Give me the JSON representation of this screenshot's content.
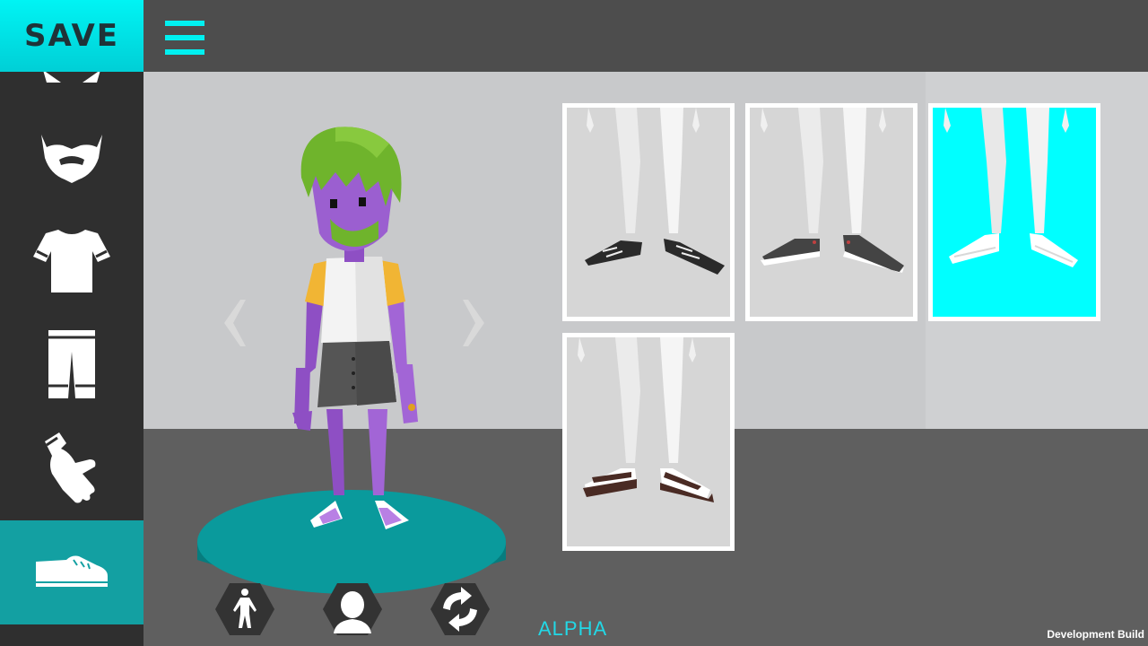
{
  "header": {
    "save_label": "SAVE",
    "menu_icon": "hamburger-menu-icon"
  },
  "sidebar": {
    "items": [
      {
        "name": "hair-category",
        "icon": "hair-icon",
        "active": false
      },
      {
        "name": "beard-category",
        "icon": "beard-icon",
        "active": false
      },
      {
        "name": "shirt-category",
        "icon": "shirt-icon",
        "active": false
      },
      {
        "name": "pants-category",
        "icon": "pants-icon",
        "active": false
      },
      {
        "name": "gloves-category",
        "icon": "glove-icon",
        "active": false
      },
      {
        "name": "shoes-category",
        "icon": "shoe-icon",
        "active": true
      }
    ]
  },
  "preview": {
    "prev_icon": "chevron-left-icon",
    "next_icon": "chevron-right-icon"
  },
  "shoe_options": [
    {
      "style": "black-sneakers",
      "selected": false
    },
    {
      "style": "dark-grey-shoes",
      "selected": false
    },
    {
      "style": "white-sandals",
      "selected": true
    },
    {
      "style": "brown-sandals",
      "selected": false
    }
  ],
  "bottom_buttons": [
    {
      "name": "body-view-button",
      "icon": "body-icon"
    },
    {
      "name": "head-view-button",
      "icon": "head-icon"
    },
    {
      "name": "randomize-button",
      "icon": "refresh-icon"
    }
  ],
  "footer": {
    "alpha_label": "ALPHA",
    "dev_build_label": "Development Build"
  },
  "colors": {
    "accent": "#00f0f0",
    "active_tab": "#13a0a2",
    "platform": "#0a9a9c",
    "skin": "#9b5fd0",
    "hair": "#6fb42c"
  }
}
